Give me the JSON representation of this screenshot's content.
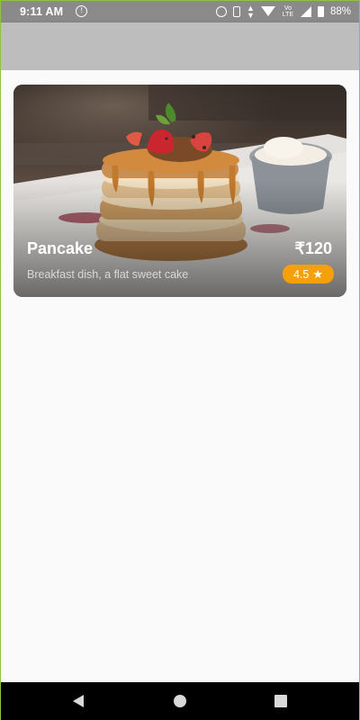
{
  "status_bar": {
    "time": "9:11 AM",
    "notification_icon": "info-circle-icon",
    "icons": [
      "alarm-icon",
      "vibrate-icon",
      "data-arrows-icon",
      "wifi-icon",
      "volte-icon",
      "signal-icon",
      "battery-icon"
    ],
    "volte_label": "Vo\nLTE",
    "battery": "88%"
  },
  "app_bar": {
    "color": "#bdbdbd"
  },
  "food_card": {
    "image": "pancake-photo",
    "name": "Pancake",
    "price": "₹120",
    "description": "Breakfast dish, a flat sweet cake",
    "rating": "4.5",
    "rating_icon": "star-icon",
    "badge_color": "#f5a00a"
  },
  "nav_bar": {
    "buttons": [
      "back-icon",
      "home-icon",
      "recents-icon"
    ]
  }
}
